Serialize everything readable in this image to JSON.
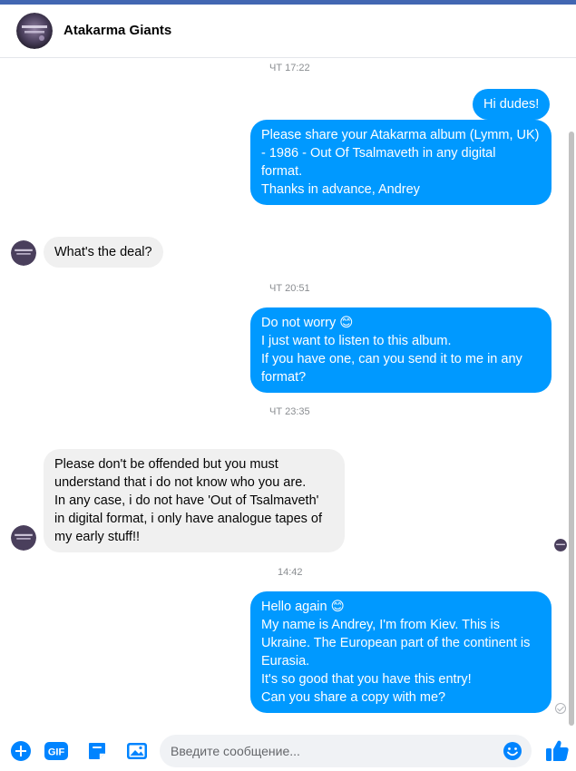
{
  "header": {
    "title": "Atakarma Giants"
  },
  "timestamps": {
    "t1": "ЧТ 17:22",
    "t2": "ЧТ 20:51",
    "t3": "ЧТ 23:35",
    "t4": "14:42"
  },
  "messages": {
    "m1": [
      "Hi dudes!"
    ],
    "m2": [
      "Please share your Atakarma album (Lymm, UK)",
      "- 1986 - Out Of Tsalmaveth in any digital",
      "format.",
      "Thanks in advance, Andrey"
    ],
    "m3": [
      "What's the deal?"
    ],
    "m4": [
      "Do not worry 😊",
      "I just want to listen to this album.",
      "If you have one, can you send it to me in any",
      "format?"
    ],
    "m5": [
      "Please don't be offended but you must",
      "understand that i do not know who you are.",
      "In any case, i do not have 'Out of Tsalmaveth'",
      "in digital format, i only have analogue tapes of",
      "my early stuff!!"
    ],
    "m6": [
      "Hello again 😊",
      "My name is Andrey, I'm from Kiev. This is",
      "Ukraine. The European part of the continent is",
      "Eurasia.",
      "It's so good that you have this entry!",
      "Can you share a copy with me?"
    ]
  },
  "composer": {
    "placeholder": "Введите сообщение..."
  },
  "icons": {
    "add": "plus-circle-icon",
    "gif": "gif-icon",
    "sticker": "sticker-icon",
    "image": "image-icon",
    "emoji": "emoji-icon",
    "like": "thumbs-up-icon"
  },
  "colors": {
    "accent": "#0099ff",
    "incoming_bubble": "#f0f0f0",
    "timestamp": "#8a8d91"
  }
}
